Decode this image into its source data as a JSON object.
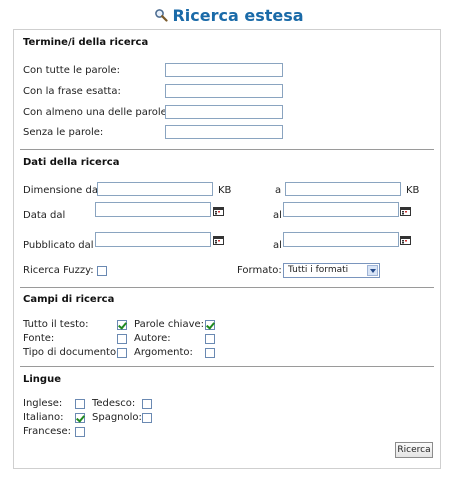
{
  "title": "Ricerca estesa",
  "icons": {
    "title_icon": "magnifier-icon",
    "calendar_icon": "calendar-icon"
  },
  "sections": {
    "terms": {
      "title": "Termine/i della ricerca",
      "fields": [
        {
          "label": "Con tutte le parole:",
          "value": ""
        },
        {
          "label": "Con la frase esatta:",
          "value": ""
        },
        {
          "label": "Con almeno una delle parole:",
          "value": ""
        },
        {
          "label": "Senza le parole:",
          "value": ""
        }
      ]
    },
    "data": {
      "title": "Dati della ricerca",
      "size_label": "Dimensione da",
      "size_unit": "KB",
      "to_label_a": "a",
      "date_label": "Data dal",
      "published_label": "Pubblicato dal",
      "to_label_al": "al",
      "fuzzy_label": "Ricerca Fuzzy:",
      "fuzzy_checked": false,
      "format_label": "Formato:",
      "format_value": "Tutti i formati"
    },
    "fields": {
      "title": "Campi di ricerca",
      "items": [
        {
          "label": "Tutto il testo:",
          "checked": true
        },
        {
          "label": "Parole chiave:",
          "checked": true
        },
        {
          "label": "Fonte:",
          "checked": false
        },
        {
          "label": "Autore:",
          "checked": false
        },
        {
          "label": "Tipo di documento:",
          "checked": false
        },
        {
          "label": "Argomento:",
          "checked": false
        }
      ]
    },
    "languages": {
      "title": "Lingue",
      "items": [
        {
          "label": "Inglese:",
          "checked": false
        },
        {
          "label": "Tedesco:",
          "checked": false
        },
        {
          "label": "Italiano:",
          "checked": true
        },
        {
          "label": "Spagnolo:",
          "checked": false
        },
        {
          "label": "Francese:",
          "checked": false
        }
      ]
    }
  },
  "search_button": "Ricerca"
}
